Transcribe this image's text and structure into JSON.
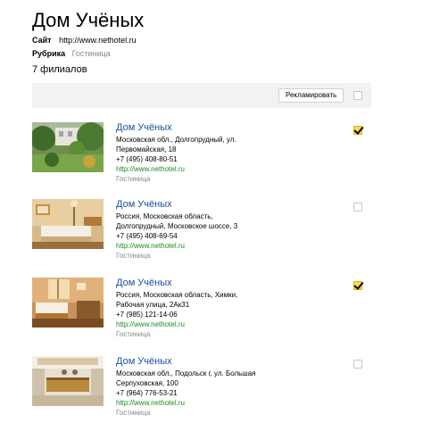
{
  "header": {
    "title": "Дом Учёных",
    "site_label": "Сайт",
    "site_value": "http://www.nethotel.ru",
    "rubric_label": "Рубрика",
    "rubric_value": "Гостиница",
    "branches_count": "7 филиалов"
  },
  "toolbar": {
    "advertise_label": "Рекламировать",
    "select_all_checked": false
  },
  "branches": [
    {
      "name": "Дом Учёных",
      "address_lines": [
        "Московская обл., Долгопрудный, ул.",
        "Первомайская, 18"
      ],
      "phone": "+7 (495) 408-80-51",
      "url": "http://www.nethotel.ru",
      "category": "Гостиница",
      "checked": true,
      "photo": "garden-photo"
    },
    {
      "name": "Дом Учёных",
      "address_lines": [
        "Россия, Московская область,",
        "Долгопрудный, Московское шоссе, 3"
      ],
      "phone": "+7 (495) 408-69-54",
      "url": "http://www.nethotel.ru",
      "category": "Гостиница",
      "checked": false,
      "photo": "hotel-room-photo"
    },
    {
      "name": "Дом Учёных",
      "address_lines": [
        "Россия, Московская область, Химки,",
        "Рабочая улица, 2Ак31"
      ],
      "phone": "+7 (985) 121-14-06",
      "url": "http://www.nethotel.ru",
      "category": "Гостиница",
      "checked": true,
      "photo": "bedroom-photo"
    },
    {
      "name": "Дом Учёных",
      "address_lines": [
        "Московская обл., Подольск г, ул. Большая",
        "Серпуховская, 100"
      ],
      "phone": "+7 (964) 776-53-21",
      "url": "http://www.nethotel.ru",
      "category": "Гостиница",
      "checked": false,
      "photo": "lobby-photo"
    }
  ],
  "colors": {
    "link": "#1a4fa0",
    "url": "#1f8a1f",
    "muted": "#888888",
    "checkbox_checked": "#ffdb4d",
    "toolbar_bg": "#f2f2f2"
  }
}
